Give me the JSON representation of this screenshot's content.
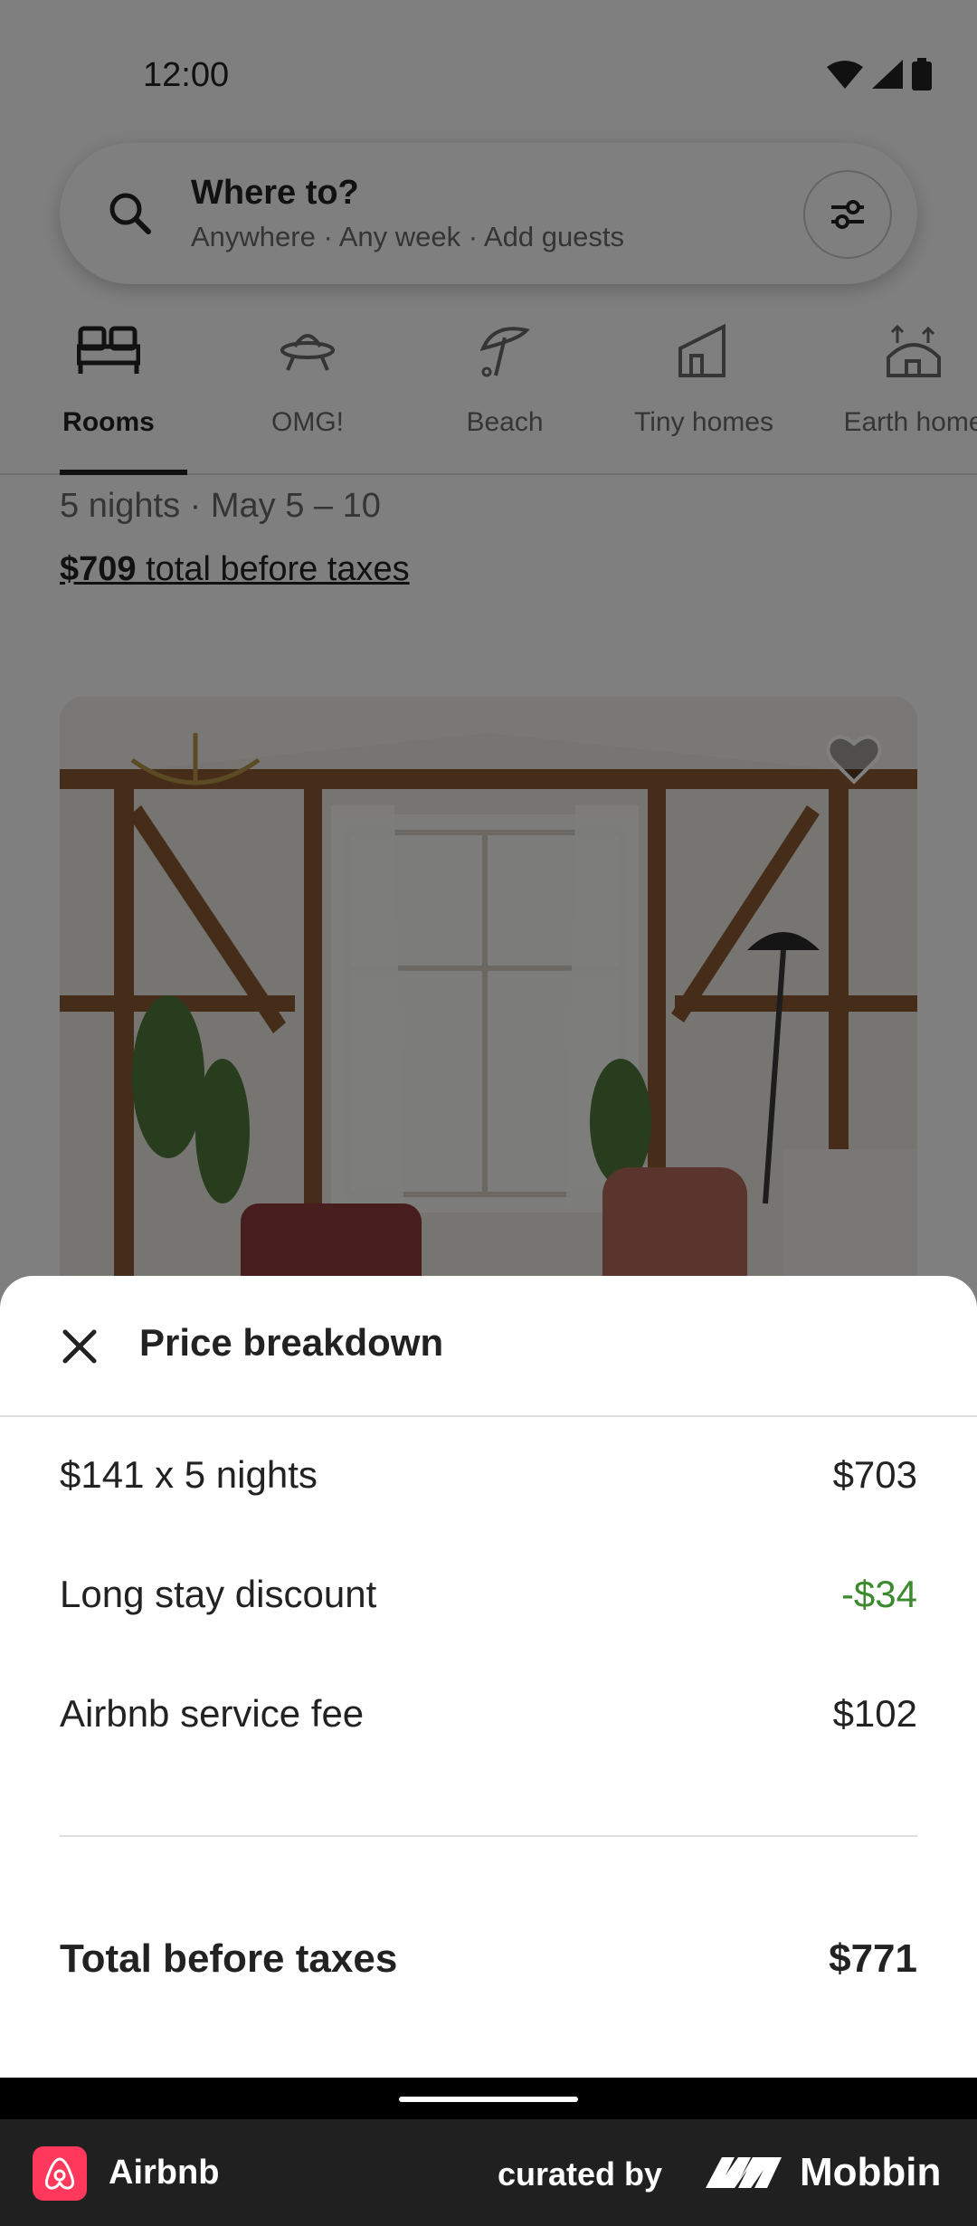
{
  "status_bar": {
    "time": "12:00"
  },
  "search": {
    "title": "Where to?",
    "subtitle": "Anywhere · Any week · Add guests"
  },
  "categories": [
    {
      "label": "Rooms",
      "icon": "beds-icon",
      "active": true
    },
    {
      "label": "OMG!",
      "icon": "ufo-icon",
      "active": false
    },
    {
      "label": "Beach",
      "icon": "umbrella-icon",
      "active": false
    },
    {
      "label": "Tiny homes",
      "icon": "tiny-home-icon",
      "active": false
    },
    {
      "label": "Earth home",
      "icon": "earth-home-icon",
      "active": false
    }
  ],
  "listing": {
    "dates": "5 nights · May 5 – 10",
    "total_amount": "$709",
    "total_suffix": " total before taxes"
  },
  "sheet": {
    "title": "Price breakdown",
    "rows": [
      {
        "label": "$141 x 5 nights",
        "value": "$703"
      },
      {
        "label": "Long stay discount",
        "value": "-$34"
      },
      {
        "label": "Airbnb service fee",
        "value": "$102"
      }
    ],
    "total": {
      "label": "Total before taxes",
      "value": "$771"
    }
  },
  "footer": {
    "app_name": "Airbnb",
    "curated_by": "curated by",
    "brand": "Mobbin"
  },
  "colors": {
    "discount": "#3c8a2e",
    "airbnb_brand": "#ff385c"
  }
}
